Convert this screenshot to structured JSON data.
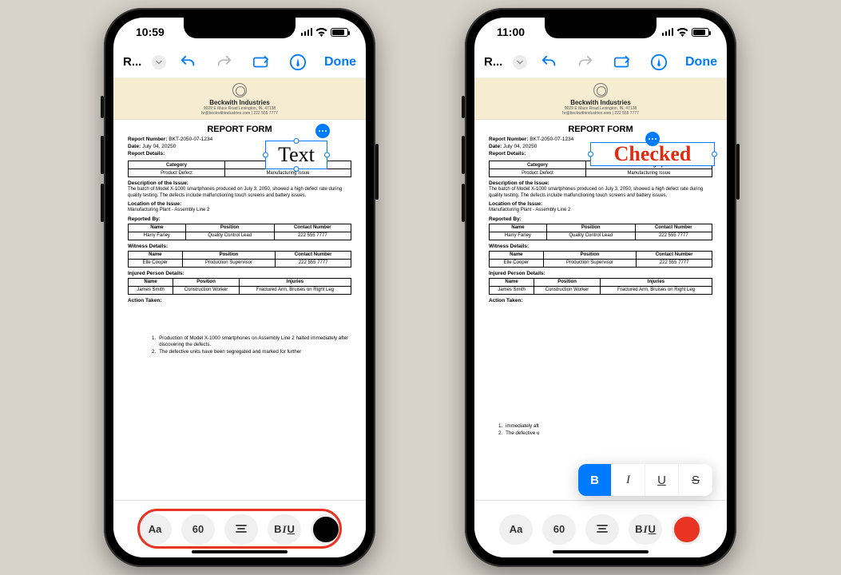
{
  "status": {
    "time_left": "10:59",
    "time_right": "11:00"
  },
  "nav": {
    "title": "R...",
    "done": "Done"
  },
  "doc": {
    "company": "Beckwith Industries",
    "addr1": "9029 E Mace Road Lexington, IN, 47138",
    "addr2": "hr@beckwithindustries.com | 222 555 7777",
    "form_title": "REPORT FORM",
    "report_no_label": "Report Number:",
    "report_no": "BKT-2050-07-1234",
    "date_label": "Date:",
    "date": "July 04, 20250",
    "details_label": "Report Details:",
    "cat_h1": "Category",
    "cat_h2": "Subcategory",
    "cat_v1": "Product Defect",
    "cat_v2": "Manufacturing Issue",
    "desc_h": "Description of the Issue:",
    "desc": "The batch of Model X-1000 smartphones produced on July 3, 2050, showed a high defect rate during quality testing. The defects include malfunctioning touch screens and battery issues.",
    "loc_h": "Location of the Issue:",
    "loc": "Manufacturing Plant - Assembly Line 2",
    "rep_h": "Reported By:",
    "tbl_name": "Name",
    "tbl_pos": "Position",
    "tbl_contact": "Contact Number",
    "tbl_inj": "Injuries",
    "rep_name": "Harry Farley",
    "rep_pos": "Quality Control Lead",
    "rep_contact": "222 555 7777",
    "wit_h": "Witness Details:",
    "wit_name": "Elle Cooper",
    "wit_pos": "Production Supervisor",
    "wit_contact": "222 555 7777",
    "inj_h": "Injured Person Details:",
    "inj_name": "James Smith",
    "inj_pos": "Construction Worker",
    "inj_val": "Fractured Arm, Bruises on Right Leg",
    "act_h": "Action Taken:",
    "li1": "Production of Model X-1000 smartphones on Assembly Line 2 halted immediately after discovering the defects.",
    "li2": "The defective units have been segregated and marked for further",
    "li1_short": "immediately aft",
    "li2_short": "The defective u"
  },
  "annot": {
    "text_left": "Text",
    "text_right": "Checked"
  },
  "toolbar": {
    "font": "Aa",
    "size": "60",
    "biu_b": "B",
    "biu_i": "I",
    "biu_u": "U",
    "biu_s": "S"
  }
}
